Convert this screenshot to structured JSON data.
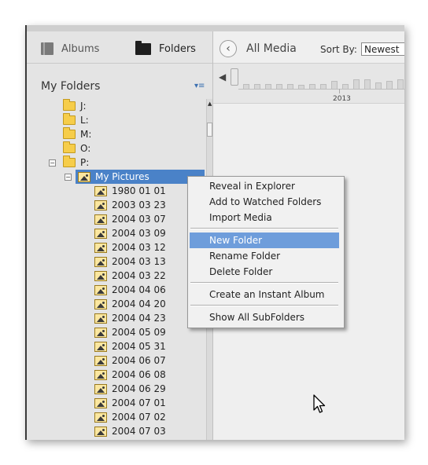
{
  "tabs": {
    "albums": "Albums",
    "folders": "Folders"
  },
  "panel_title": "My Folders",
  "tree": {
    "drives": [
      "J:",
      "L:",
      "M:",
      "O:",
      "P:"
    ],
    "selected_folder": "My Pictures",
    "subfolders": [
      "1980 01 01",
      "2003 03 23",
      "2004 03 07",
      "2004 03 09",
      "2004 03 12",
      "2004 03 13",
      "2004 03 22",
      "2004 04 06",
      "2004 04 20",
      "2004 04 23",
      "2004 05 09",
      "2004 05 31",
      "2004 06 07",
      "2004 06 08",
      "2004 06 29",
      "2004 07 01",
      "2004 07 02",
      "2004 07 03"
    ]
  },
  "toolbar": {
    "view_title": "All Media",
    "sort_label": "Sort By:",
    "sort_value": "Newest"
  },
  "timeline": {
    "year_label": "2013"
  },
  "context_menu": {
    "group1": [
      "Reveal in Explorer",
      "Add to Watched Folders",
      "Import Media"
    ],
    "group2": [
      "New Folder",
      "Rename Folder",
      "Delete Folder"
    ],
    "group3": [
      "Create an Instant Album"
    ],
    "group4": [
      "Show All SubFolders"
    ],
    "highlighted": "New Folder"
  }
}
